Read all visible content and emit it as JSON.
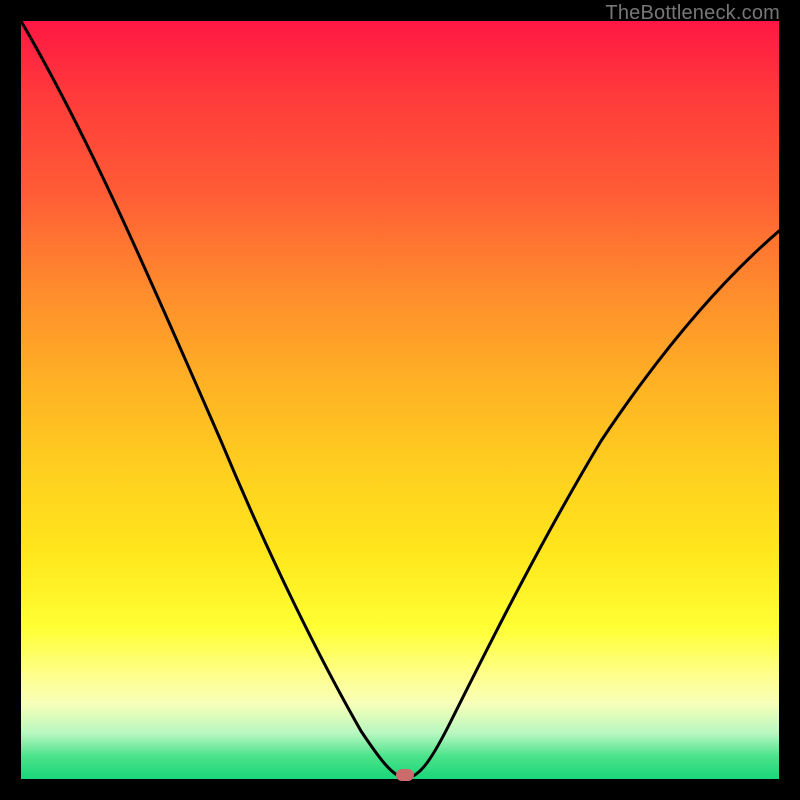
{
  "watermark": "TheBottleneck.com",
  "chart_data": {
    "type": "line",
    "title": "",
    "xlabel": "",
    "ylabel": "",
    "xlim": [
      0,
      100
    ],
    "ylim": [
      0,
      100
    ],
    "series": [
      {
        "name": "bottleneck-curve",
        "x": [
          0,
          5,
          10,
          15,
          20,
          25,
          30,
          35,
          40,
          45,
          48,
          50,
          52,
          55,
          60,
          65,
          70,
          75,
          80,
          85,
          90,
          95,
          100
        ],
        "y": [
          100,
          90,
          80,
          70,
          60,
          50,
          40,
          30,
          20,
          8,
          2,
          0,
          2,
          7,
          16,
          25,
          33,
          40,
          47,
          53,
          59,
          64,
          69
        ]
      }
    ],
    "marker": {
      "x": 50,
      "y": 0
    },
    "gradient_bands": [
      {
        "name": "severe-bottleneck",
        "color": "#ff1744"
      },
      {
        "name": "high-bottleneck",
        "color": "#ff8a2d"
      },
      {
        "name": "moderate-bottleneck",
        "color": "#ffe61c"
      },
      {
        "name": "low-bottleneck",
        "color": "#ffff88"
      },
      {
        "name": "optimal",
        "color": "#1ad67a"
      }
    ]
  }
}
